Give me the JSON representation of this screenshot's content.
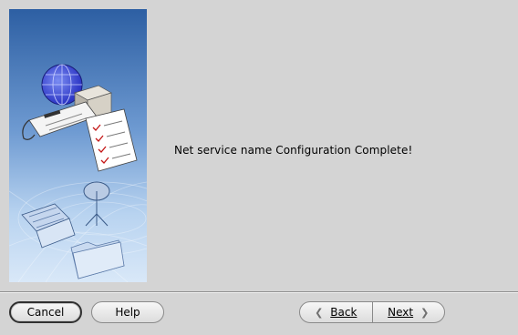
{
  "message": "Net service name Configuration Complete!",
  "buttons": {
    "cancel": "Cancel",
    "help": "Help",
    "back": "Back",
    "next": "Next"
  },
  "icons": {
    "back": "chevron-left-icon",
    "next": "chevron-right-icon"
  },
  "colors": {
    "background": "#d4d4d4",
    "panel_top": "#2f62a6",
    "panel_bottom": "#cfe2f6"
  }
}
